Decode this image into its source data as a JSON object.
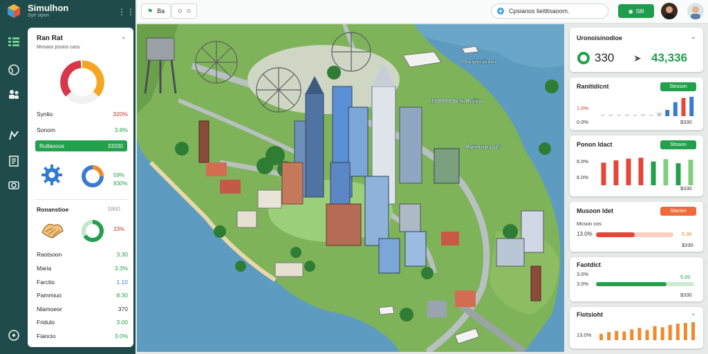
{
  "app": {
    "title": "Simulhon",
    "subtitle": "Sytr sipon"
  },
  "colors": {
    "rail": "#1f4b4b",
    "accent_green": "#23a04c",
    "accent_red": "#e2504a",
    "accent_orange": "#f08a2c",
    "accent_blue": "#3a7bd0"
  },
  "rail_icons": [
    "grid-icon",
    "globe-icon",
    "people-icon",
    "chart-icon",
    "document-icon",
    "camera-icon",
    "help-icon"
  ],
  "topbar": {
    "btn1_label": "Ba",
    "search_text": "Cpsianos lieititsaoom.",
    "go_label": "S8l"
  },
  "left_panel": {
    "title": "Ran Rat",
    "subtitle": "Mosaos pssios cass",
    "stats": [
      {
        "label": "Synlio",
        "value": "320%",
        "color": "#c0392b"
      },
      {
        "label": "Sonom",
        "value": "3.8%",
        "color": "#23a04c"
      }
    ],
    "green_bar": {
      "label": "Rutlaooos",
      "value": "33330"
    },
    "donut1": {
      "line1": "59%",
      "line2": "830%"
    },
    "section_title": "Ronanstioe",
    "section_right": "5860",
    "donut2_value": "33%",
    "list": [
      {
        "label": "Raotsoon",
        "value": "3.30",
        "color": "#23a04c"
      },
      {
        "label": "Maria",
        "value": "3.3%",
        "color": "#23a04c"
      },
      {
        "label": "Farctio",
        "value": "1.10",
        "color": "#3a7bd0"
      },
      {
        "label": "Pammiuo",
        "value": "8.30",
        "color": "#23a04c"
      },
      {
        "label": "Nlamoeor",
        "value": "370",
        "color": "#333333"
      },
      {
        "label": "Fridulo",
        "value": "3.00",
        "color": "#23a04c"
      },
      {
        "label": "Fiancio",
        "value": "3.0%",
        "color": "#23a04c"
      }
    ]
  },
  "map_labels": {
    "a": "Monioisiinon",
    "b": "160000 8ek Rciiro",
    "c": "Rymopcoos"
  },
  "right_cards": {
    "card1": {
      "title": "Uronoisinodioe",
      "value1": "330",
      "value2": "43,336"
    },
    "card2": {
      "title": "Ranitidicnt",
      "badge": "Stesson",
      "left_top": "1.0%",
      "left_bottom": "0.0%",
      "right_bottom": "$330",
      "values": [
        0.04,
        0.08,
        0.06,
        0.09,
        0.05,
        0.1,
        0.07,
        0.18,
        0.32,
        0.72,
        0.94,
        1.0
      ]
    },
    "card3": {
      "title": "Ponon Idact",
      "badge": "Sttsaon",
      "left_top": "6.0%",
      "left_bottom": "6.0%",
      "right_bottom": "$330",
      "values": [
        0.78,
        0.86,
        0.92,
        0.95,
        0.82,
        0.9,
        0.76,
        0.88
      ]
    },
    "card4": {
      "title": "Musoon Idet",
      "badge": "Stacion",
      "sub_left": "Mcsoo cos",
      "left_value": "13.0%",
      "right_value": "5.30",
      "right_bottom": "$330",
      "progress": 0.5
    },
    "card5": {
      "title": "Faotdict",
      "left_top": "3.0%",
      "left_bottom": "3.0%",
      "right_value": "5.00",
      "right_bottom": "$330",
      "progress": 0.72
    },
    "card6": {
      "title": "Fiotsioht",
      "left_value": "13.0%",
      "values": [
        0.35,
        0.45,
        0.52,
        0.48,
        0.6,
        0.68,
        0.56,
        0.78,
        0.72,
        0.85,
        0.92,
        0.96,
        1.0
      ]
    }
  }
}
